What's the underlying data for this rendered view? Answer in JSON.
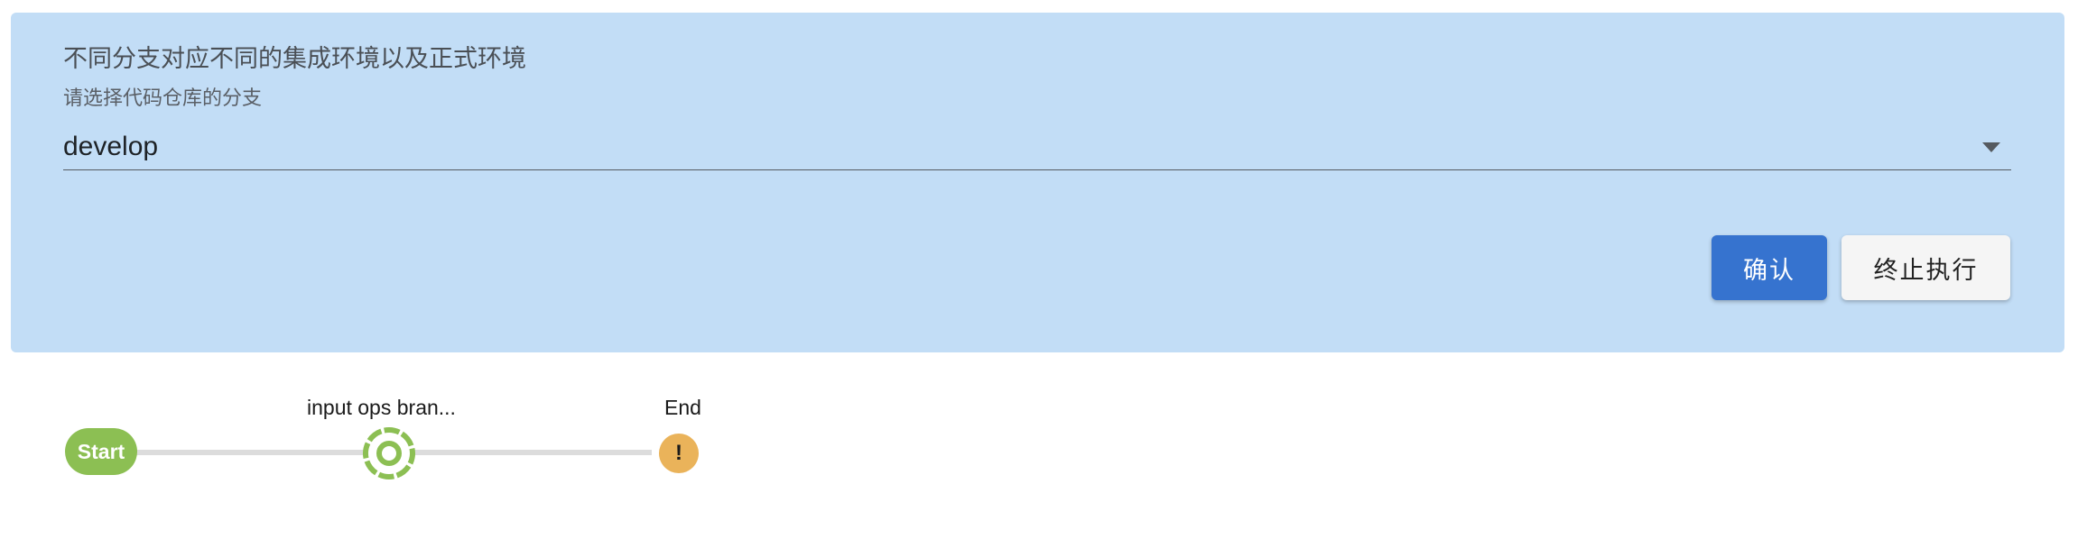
{
  "input_panel": {
    "message": "不同分支对应不同的集成环境以及正式环境",
    "field_label": "请选择代码仓库的分支",
    "selected_branch": "develop",
    "confirm_label": "确认",
    "abort_label": "终止执行"
  },
  "pipeline": {
    "start_label": "Start",
    "stage_label": "input ops bran...",
    "end_label": "End",
    "end_icon": "!"
  },
  "colors": {
    "panel_bg": "#c2ddf6",
    "confirm_bg": "#3673cf",
    "success_green": "#8cbf53",
    "warning_orange": "#eab35a"
  }
}
